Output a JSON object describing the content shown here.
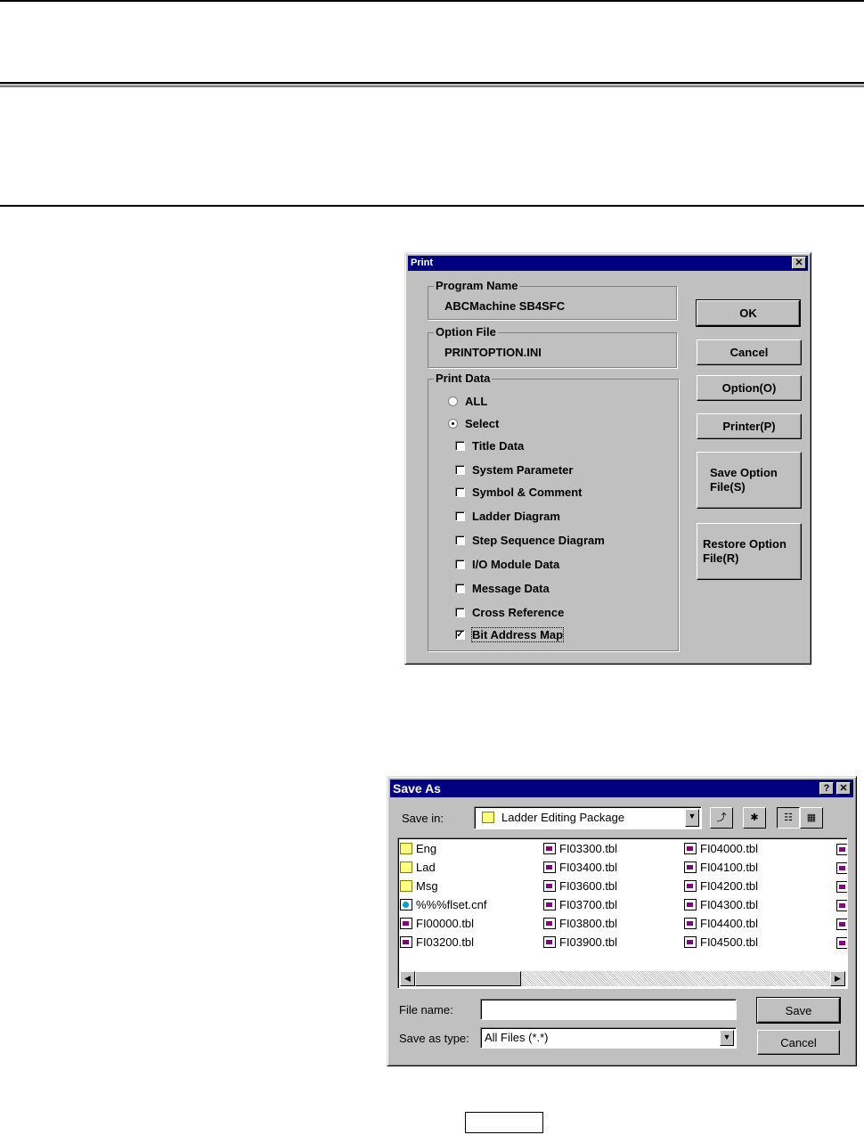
{
  "print_dialog": {
    "title": "Print",
    "close_glyph": "✕",
    "program_name_label": "Program Name",
    "program_name_value": "ABCMachine SB4SFC",
    "option_file_label": "Option File",
    "option_file_value": "PRINTOPTION.INI",
    "print_data_label": "Print Data",
    "radio_all": "ALL",
    "radio_select": "Select",
    "selected_radio": "Select",
    "checkboxes": [
      {
        "label": "Title Data",
        "checked": false
      },
      {
        "label": "System Parameter",
        "checked": false
      },
      {
        "label": "Symbol & Comment",
        "checked": false
      },
      {
        "label": "Ladder Diagram",
        "checked": false
      },
      {
        "label": "Step Sequence Diagram",
        "checked": false
      },
      {
        "label": "I/O Module Data",
        "checked": false
      },
      {
        "label": "Message Data",
        "checked": false
      },
      {
        "label": "Cross Reference",
        "checked": false
      },
      {
        "label": "Bit Address Map",
        "checked": true
      }
    ],
    "buttons": {
      "ok": "OK",
      "cancel": "Cancel",
      "option": "Option(O)",
      "printer": "Printer(P)",
      "save_option_line1": "Save Option",
      "save_option_line2": "File(S)",
      "restore_option_line1": "Restore Option",
      "restore_option_line2": "File(R)"
    }
  },
  "save_as_dialog": {
    "title": "Save As",
    "help_glyph": "?",
    "close_glyph": "✕",
    "save_in_label": "Save in:",
    "save_in_value": "Ladder Editing Package",
    "files_col1": [
      {
        "name": "Eng",
        "type": "folder"
      },
      {
        "name": "Lad",
        "type": "folder"
      },
      {
        "name": "Msg",
        "type": "folder"
      },
      {
        "name": "%%%flset.cnf",
        "type": "cnf"
      },
      {
        "name": "FI00000.tbl",
        "type": "tbl"
      },
      {
        "name": "FI03200.tbl",
        "type": "tbl"
      }
    ],
    "files_col2": [
      {
        "name": "FI03300.tbl"
      },
      {
        "name": "FI03400.tbl"
      },
      {
        "name": "FI03600.tbl"
      },
      {
        "name": "FI03700.tbl"
      },
      {
        "name": "FI03800.tbl"
      },
      {
        "name": "FI03900.tbl"
      }
    ],
    "files_col3": [
      {
        "name": "FI04000.tbl"
      },
      {
        "name": "FI04100.tbl"
      },
      {
        "name": "FI04200.tbl"
      },
      {
        "name": "FI04300.tbl"
      },
      {
        "name": "FI04400.tbl"
      },
      {
        "name": "FI04500.tbl"
      }
    ],
    "file_name_label": "File name:",
    "file_name_value": "",
    "save_type_label": "Save as type:",
    "save_type_value": "All Files (*.*)",
    "save_button": "Save",
    "cancel_button": "Cancel"
  }
}
